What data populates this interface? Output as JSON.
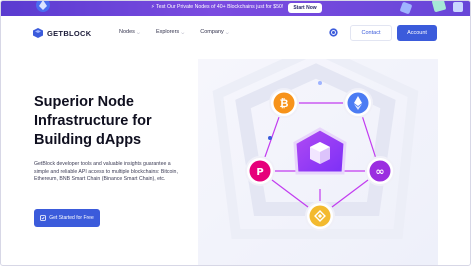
{
  "promo": {
    "text": "⚡ Test Our Private Nodes of 40+ Blockchains just for $50!",
    "button": "Start Now"
  },
  "nav": {
    "logo": "GETBLOCK",
    "menu": [
      {
        "label": "Nodes"
      },
      {
        "label": "Explorers"
      },
      {
        "label": "Company"
      }
    ],
    "contact": "Contact",
    "account": "Account"
  },
  "hero": {
    "title_lines": [
      "Superior Node",
      "Infrastructure for",
      "Building dApps"
    ],
    "description": "GetBlock developer tools and valuable insights guarantee a simple and reliable API access to multiple blockchains: Bitcoin, Ethereum, BNB Smart Chain (Binance Smart Chain), etc.",
    "cta": "Get Started for Free"
  },
  "diagram": {
    "nodes": [
      {
        "name": "bitcoin",
        "color": "#f7931a",
        "symbol": "₿"
      },
      {
        "name": "ethereum",
        "color": "#4c7cf3",
        "symbol": "◆"
      },
      {
        "name": "polygon",
        "color": "#9b2ee0",
        "symbol": "∞"
      },
      {
        "name": "bnb",
        "color": "#f3ba2f",
        "symbol": "◈"
      },
      {
        "name": "polkadot",
        "color": "#e6007a",
        "symbol": "P"
      }
    ],
    "center_color": "#8e2de2",
    "link_color": "#c23bf0"
  }
}
